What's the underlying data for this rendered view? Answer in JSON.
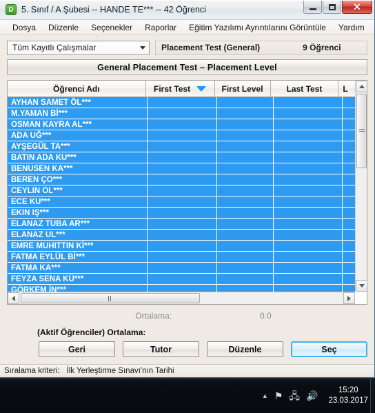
{
  "window": {
    "title": "5. Sınıf / A Şubesi -- HANDE TE*** -- 42 Öğrenci",
    "app_icon": "D",
    "controls": {
      "minimize": "minimize-icon",
      "maximize": "maximize-icon",
      "close": "✕"
    }
  },
  "menubar": {
    "items": [
      {
        "label": "Dosya"
      },
      {
        "label": "Düzenle"
      },
      {
        "label": "Seçenekler"
      },
      {
        "label": "Raporlar"
      },
      {
        "label": "Eğitim Yazılımı Ayrıntılarını Görüntüle"
      },
      {
        "label": "Yardım"
      }
    ]
  },
  "toolbar": {
    "filter_combo_value": "Tüm Kayıtlı Çalışmalar",
    "info_test": "Placement Test (General)",
    "info_count": "9 Öğrenci"
  },
  "banner": {
    "title": "General Placement Test  –  Placement Level"
  },
  "grid": {
    "columns": [
      {
        "key": "name",
        "label": "Öğrenci Adı",
        "sorted": false
      },
      {
        "key": "first",
        "label": "First Test",
        "sorted": true
      },
      {
        "key": "level",
        "label": "First Level",
        "sorted": false
      },
      {
        "key": "last",
        "label": "Last Test",
        "sorted": false
      },
      {
        "key": "extra",
        "label": "L",
        "sorted": false
      }
    ],
    "rows": [
      {
        "name": "AYHAN SAMET ÖL***",
        "first": "",
        "level": "",
        "last": "",
        "extra": ""
      },
      {
        "name": "M.YAMAN Bİ***",
        "first": "",
        "level": "",
        "last": "",
        "extra": ""
      },
      {
        "name": "OSMAN KAYRA AL***",
        "first": "",
        "level": "",
        "last": "",
        "extra": ""
      },
      {
        "name": "ADA UĞ***",
        "first": "",
        "level": "",
        "last": "",
        "extra": ""
      },
      {
        "name": "AYŞEGÜL TA***",
        "first": "",
        "level": "",
        "last": "",
        "extra": ""
      },
      {
        "name": "BATIN ADA KU***",
        "first": "",
        "level": "",
        "last": "",
        "extra": ""
      },
      {
        "name": "BENUSEN KA***",
        "first": "",
        "level": "",
        "last": "",
        "extra": ""
      },
      {
        "name": "BEREN ÇO***",
        "first": "",
        "level": "",
        "last": "",
        "extra": ""
      },
      {
        "name": "CEYLIN OL***",
        "first": "",
        "level": "",
        "last": "",
        "extra": ""
      },
      {
        "name": "ECE KU***",
        "first": "",
        "level": "",
        "last": "",
        "extra": ""
      },
      {
        "name": "EKIN IŞ***",
        "first": "",
        "level": "",
        "last": "",
        "extra": ""
      },
      {
        "name": "ELANAZ TUBA AR***",
        "first": "",
        "level": "",
        "last": "",
        "extra": ""
      },
      {
        "name": "ELANAZ UL***",
        "first": "",
        "level": "",
        "last": "",
        "extra": ""
      },
      {
        "name": "EMRE MUHITTIN Kİ***",
        "first": "",
        "level": "",
        "last": "",
        "extra": ""
      },
      {
        "name": "FATMA EYLÜL Bİ***",
        "first": "",
        "level": "",
        "last": "",
        "extra": ""
      },
      {
        "name": "FATMA KA***",
        "first": "",
        "level": "",
        "last": "",
        "extra": ""
      },
      {
        "name": "FEYZA SENA KÜ***",
        "first": "",
        "level": "",
        "last": "",
        "extra": ""
      },
      {
        "name": "GÖRKEM İN***",
        "first": "",
        "level": "",
        "last": "",
        "extra": ""
      }
    ],
    "selection_color": "#2f9bf0",
    "sort_arrow_color": "#2196f3"
  },
  "averages": {
    "average_label": "Ortalama:",
    "average_value": "0.0",
    "active_average_label": "(Aktif Öğrenciler) Ortalama:"
  },
  "buttons": {
    "back": "Geri",
    "tutor": "Tutor",
    "edit": "Düzenle",
    "select": "Seç",
    "select_focus_color": "#3fb3e8"
  },
  "statusbar": {
    "label": "Sıralama kriteri:",
    "value": "İlk Yerleştirme Sınavı'nın Tarihi"
  },
  "taskbar": {
    "clock_time": "15:20",
    "clock_date": "23.03.2017",
    "tray": [
      {
        "name": "show-hidden-icons",
        "glyph": "▲"
      },
      {
        "name": "flag-action-center-icon",
        "glyph": "⚑"
      },
      {
        "name": "network-icon",
        "glyph": "🖧"
      },
      {
        "name": "volume-icon",
        "glyph": "🔊"
      }
    ]
  }
}
